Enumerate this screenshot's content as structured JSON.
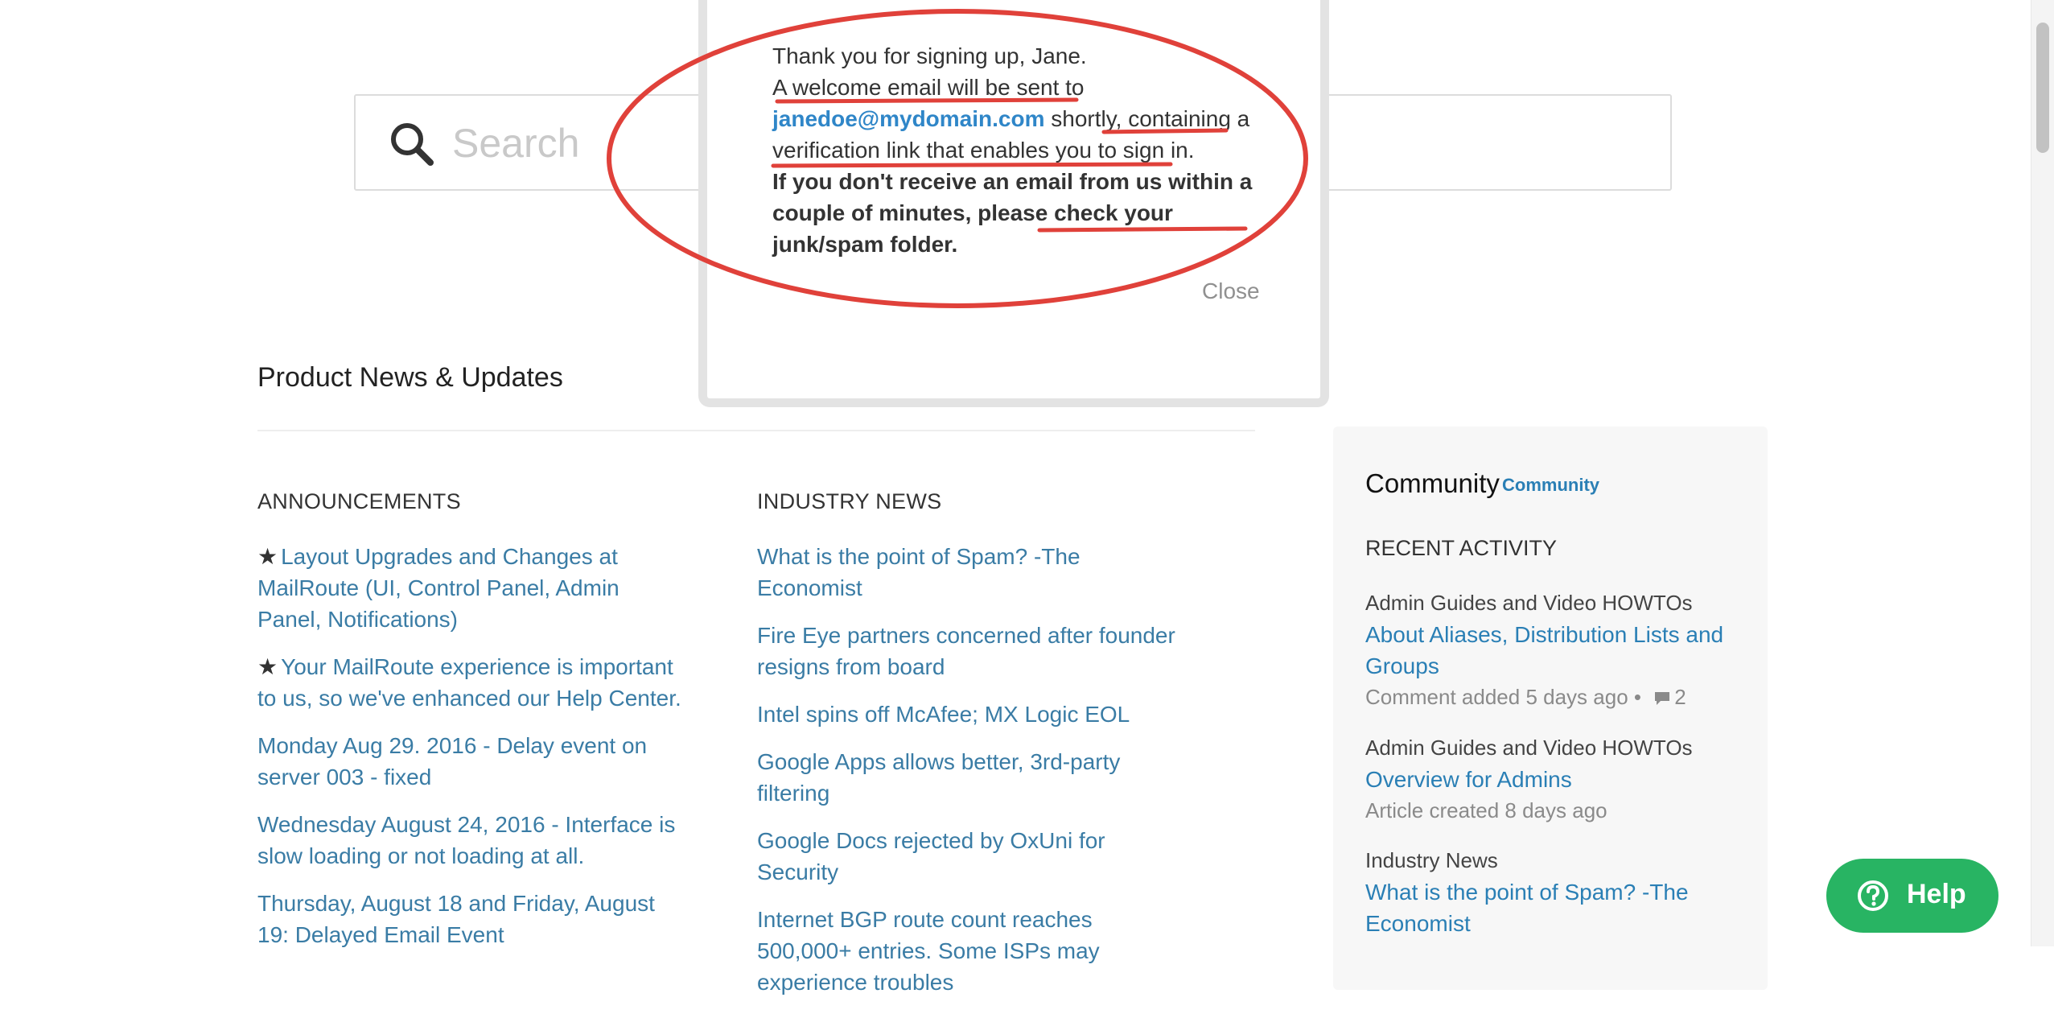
{
  "search": {
    "placeholder": "Search"
  },
  "modal": {
    "line1": "Thank you for signing up, Jane.",
    "line2_prefix": "A welcome email will be sent to",
    "email": "janedoe@mydomain.com",
    "line2_suffix": "shortly, containing a verification link that enables you to sign in.",
    "warning": "If you don't receive an email from us within a couple of minutes, please check your junk/spam folder.",
    "close_label": "Close",
    "annotation_color": "#e0413a"
  },
  "news": {
    "title": "Product News & Updates",
    "announcements": {
      "heading": "ANNOUNCEMENTS",
      "items": [
        {
          "star": true,
          "label": "Layout Upgrades and Changes at MailRoute (UI, Control Panel, Admin Panel, Notifications)"
        },
        {
          "star": true,
          "label": "Your MailRoute experience is important to us, so we've enhanced our Help Center."
        },
        {
          "star": false,
          "label": "Monday Aug 29. 2016 - Delay event on server 003 - fixed"
        },
        {
          "star": false,
          "label": "Wednesday August 24, 2016 - Interface is slow loading or not loading at all."
        },
        {
          "star": false,
          "label": "Thursday, August 18 and Friday, August 19: Delayed Email Event"
        }
      ]
    },
    "industry": {
      "heading": "INDUSTRY NEWS",
      "items": [
        {
          "label": "What is the point of Spam? -The Economist"
        },
        {
          "label": "Fire Eye partners concerned after founder resigns from board"
        },
        {
          "label": "Intel spins off McAfee; MX Logic EOL"
        },
        {
          "label": "Google Apps allows better, 3rd-party filtering"
        },
        {
          "label": "Google Docs rejected by OxUni for Security"
        },
        {
          "label": "Internet BGP route count reaches 500,000+ entries. Some ISPs may experience troubles"
        }
      ]
    }
  },
  "community": {
    "title": "Community",
    "link_label": "Community",
    "recent_heading": "RECENT ACTIVITY",
    "activities": [
      {
        "category": "Admin Guides and Video HOWTOs",
        "title": "About Aliases, Distribution Lists and Groups",
        "meta": "Comment added 5 days ago",
        "comments": "2"
      },
      {
        "category": "Admin Guides and Video HOWTOs",
        "title": "Overview for Admins",
        "meta": "Article created 8 days ago",
        "comments": ""
      },
      {
        "category": "Industry News",
        "title": "What is the point of Spam? -The Economist",
        "meta": "",
        "comments": ""
      }
    ]
  },
  "help": {
    "label": "Help",
    "icon": "help-circle-icon",
    "color": "#28b463"
  },
  "colors": {
    "link": "#3a7ca5",
    "accent_link": "#2a7fb5"
  }
}
